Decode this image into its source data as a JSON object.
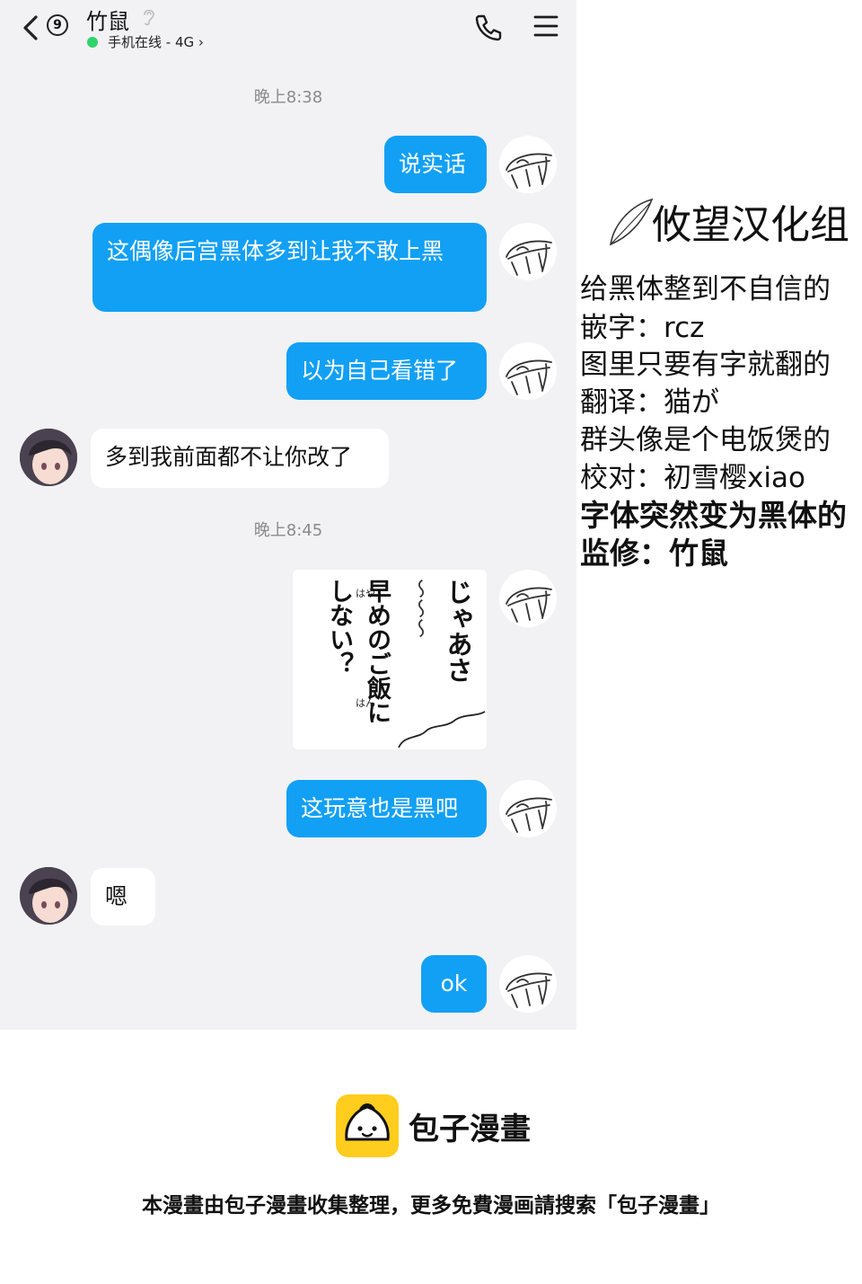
{
  "header": {
    "back_badge": "9",
    "contact_name": "竹鼠",
    "status": "手机在线 - 4G",
    "icons": [
      "back-chevron-icon",
      "hearing-icon",
      "phone-icon",
      "menu-icon"
    ]
  },
  "messages": [
    {
      "type": "time",
      "text": "晚上8:38"
    },
    {
      "type": "out",
      "text": "说实话"
    },
    {
      "type": "out",
      "text": "这偶像后宫黑体多到让我不敢上黑"
    },
    {
      "type": "out",
      "text": "以为自己看错了"
    },
    {
      "type": "in",
      "text": "多到我前面都不让你改了"
    },
    {
      "type": "time",
      "text": "晚上8:45"
    },
    {
      "type": "out-sticker",
      "text_columns": [
        "じゃあさ",
        "〜〜〜",
        "早めのご飯に",
        "しない？"
      ],
      "ruby": [
        "はや",
        "はん"
      ]
    },
    {
      "type": "out",
      "text": "这玩意也是黑吧"
    },
    {
      "type": "in",
      "text": "嗯"
    },
    {
      "type": "out",
      "text": "ok"
    }
  ],
  "credits": {
    "group_logo": "攸望汉化组",
    "lines": [
      "给黑体整到不自信的",
      "嵌字：rcz",
      "图里只要有字就翻的",
      "翻译：猫が",
      "群头像是个电饭煲的",
      "校对：初雪樱xiao",
      "字体突然变为黑体的",
      "监修：竹鼠"
    ]
  },
  "footer": {
    "brand": "包子漫畫",
    "note": "本漫畫由包子漫畫收集整理，更多免費漫画請搜索「包子漫畫」"
  },
  "colors": {
    "outgoing_bubble": "#12a0f4",
    "incoming_bubble": "#ffffff",
    "chat_background": "#f2f2f4",
    "online_dot": "#2fd46d",
    "footer_logo": "#ffcd1e"
  }
}
